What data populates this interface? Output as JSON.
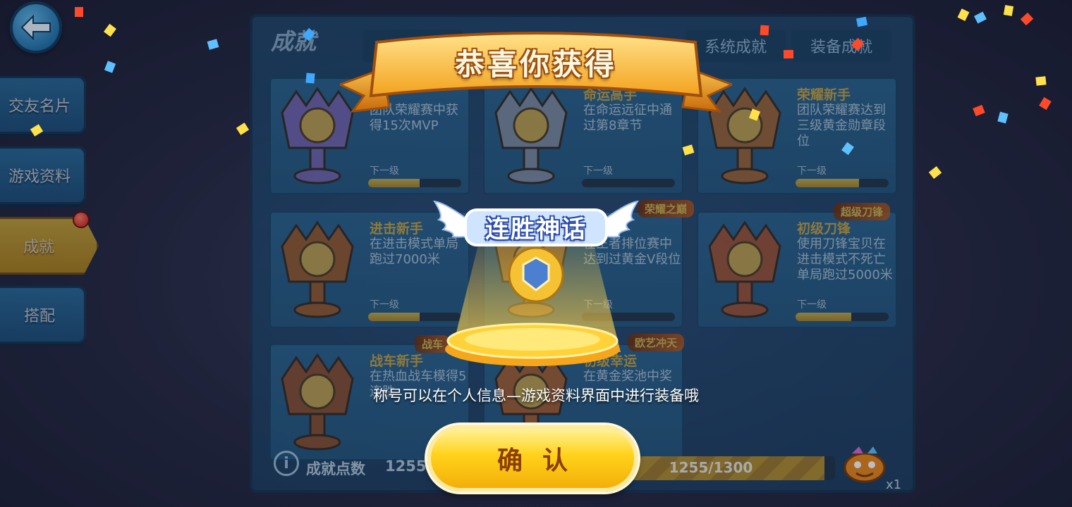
{
  "sidebar": {
    "items": [
      {
        "label": "交友名片"
      },
      {
        "label": "游戏资料"
      },
      {
        "label": "成就"
      },
      {
        "label": "搭配"
      }
    ]
  },
  "panel": {
    "title": "成就",
    "tabs": [
      {
        "label": ""
      },
      {
        "label": "系统成就"
      },
      {
        "label": "装备成就"
      }
    ]
  },
  "cards": [
    {
      "title": "",
      "desc": "团队荣耀赛中获得15次MVP",
      "next": "下一级",
      "progress": 0.55
    },
    {
      "title": "命运高手",
      "desc": "在命运远征中通过第8章节",
      "next": "下一级",
      "progress": 0.0
    },
    {
      "title": "荣耀新手",
      "desc": "团队荣耀赛达到三级黄金勋章段位",
      "next": "下一级",
      "progress": 0.68
    },
    {
      "title": "进击新手",
      "desc": "在进击模式单局跑过7000米",
      "next": "下一级",
      "progress": 0.55
    },
    {
      "title": "",
      "desc": "在王者排位赛中达到过黄金V段位",
      "next": "下一级",
      "progress": 0.0
    },
    {
      "title": "初级刀锋",
      "desc": "使用刀锋宝贝在进击模式不死亡单局跑过5000米",
      "next": "下一级",
      "progress": 0.6
    },
    {
      "title": "战车新手",
      "desc": "在热血战车模得5连胜",
      "next": "",
      "progress": 0
    },
    {
      "title": "初级幸运",
      "desc": "在黄金奖池中奖",
      "next": "",
      "progress": 0
    }
  ],
  "tags": {
    "tag1": "荣耀之巅",
    "tag2": "超级刀锋",
    "tag3": "战车",
    "tag4": "欧艺冲天"
  },
  "bottom": {
    "info_icon": "i",
    "points_label": "成就点数",
    "points_value": "1255",
    "progress_text": "1255/1300",
    "progress_fraction": 0.965,
    "reward_count": "x1"
  },
  "popup": {
    "banner": "恭喜你获得",
    "title_badge": "连胜神话",
    "hint": "称号可以在个人信息—游戏资料界面中进行装备哦",
    "confirm": "确认"
  },
  "colors": {
    "accent_gold": "#ffc53a",
    "panel_blue": "#1f5a86",
    "button_gold": "#ffd21a"
  }
}
